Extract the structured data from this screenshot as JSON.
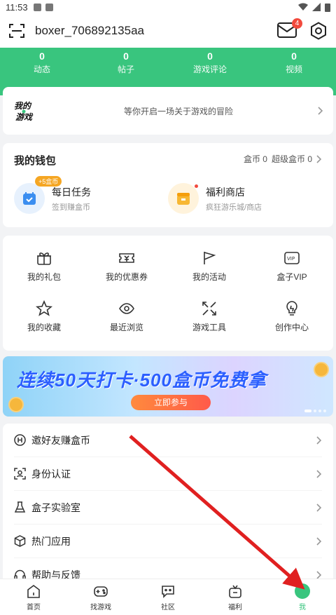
{
  "status": {
    "time": "11:53"
  },
  "header": {
    "username": "boxer_706892135aa",
    "mail_badge": "4"
  },
  "stats": [
    {
      "value": "0",
      "label": "动态"
    },
    {
      "value": "0",
      "label": "帖子"
    },
    {
      "value": "0",
      "label": "游戏评论"
    },
    {
      "value": "0",
      "label": "视频"
    }
  ],
  "game_card": {
    "logo_text": "我的游戏",
    "tagline": "等你开启一场关于游戏的冒险"
  },
  "wallet": {
    "title": "我的钱包",
    "coins": "盒币 0",
    "super_coins": "超级盒币 0",
    "items": [
      {
        "title": "每日任务",
        "sub": "签到赚盒币",
        "pill": "+5盒币"
      },
      {
        "title": "福利商店",
        "sub": "疯狂游乐城/商店"
      }
    ]
  },
  "grid": [
    {
      "label": "我的礼包",
      "icon": "gift-icon"
    },
    {
      "label": "我的优惠券",
      "icon": "coupon-icon"
    },
    {
      "label": "我的活动",
      "icon": "flag-icon"
    },
    {
      "label": "盒子VIP",
      "icon": "vip-icon"
    },
    {
      "label": "我的收藏",
      "icon": "star-icon"
    },
    {
      "label": "最近浏览",
      "icon": "eye-icon"
    },
    {
      "label": "游戏工具",
      "icon": "tool-icon"
    },
    {
      "label": "创作中心",
      "icon": "bulb-icon"
    }
  ],
  "banner": {
    "title": "连续50天打卡·500盒币免费拿",
    "button": "立即参与"
  },
  "list": [
    {
      "label": "邀好友赚盒币",
      "icon": "h-coin-icon"
    },
    {
      "label": "身份认证",
      "icon": "id-icon"
    },
    {
      "label": "盒子实验室",
      "icon": "flask-icon"
    },
    {
      "label": "热门应用",
      "icon": "cube-icon"
    },
    {
      "label": "帮助与反馈",
      "icon": "headset-icon"
    }
  ],
  "tabbar": [
    {
      "label": "首页",
      "icon": "home-icon"
    },
    {
      "label": "找游戏",
      "icon": "gamepad-icon"
    },
    {
      "label": "社区",
      "icon": "chat-icon"
    },
    {
      "label": "福利",
      "icon": "gift-box-icon"
    },
    {
      "label": "我",
      "icon": "me-icon"
    }
  ],
  "colors": {
    "brand": "#39c57e",
    "badge": "#f24a3d",
    "arrow": "#e02020"
  }
}
